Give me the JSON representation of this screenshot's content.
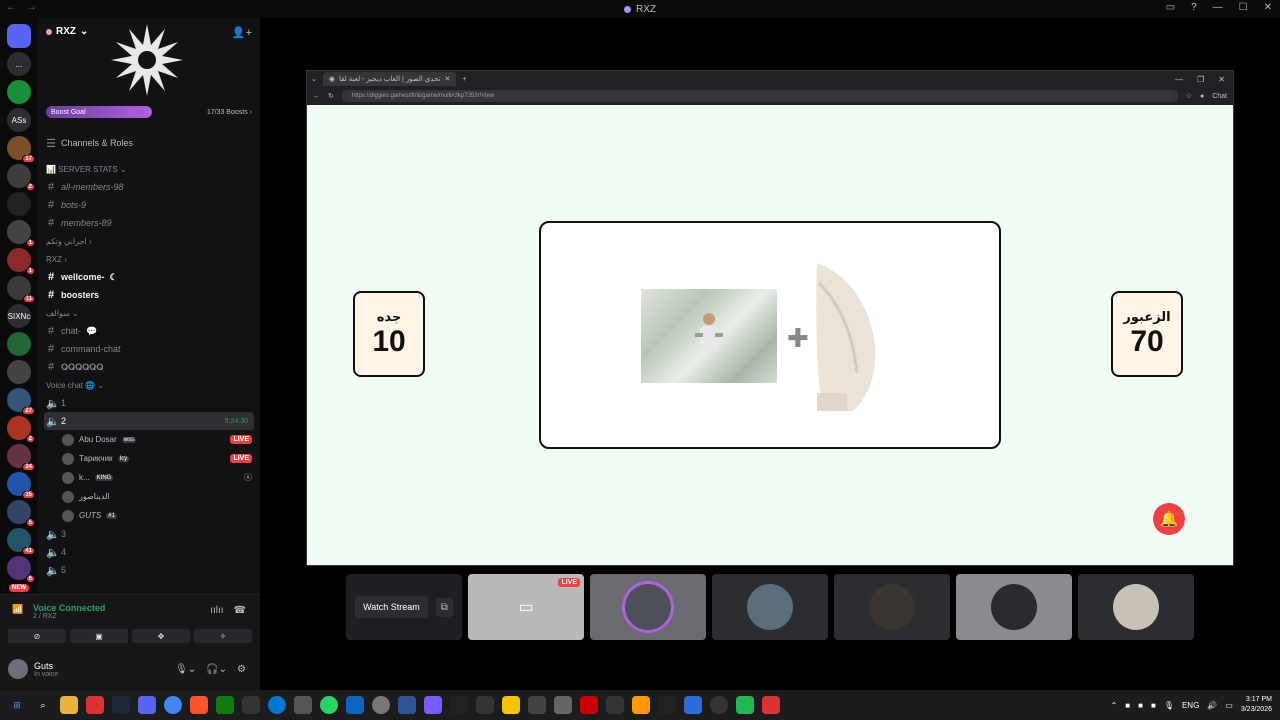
{
  "window": {
    "title": "RXZ"
  },
  "guild_rail": {
    "items": [
      {
        "name": "discord-home-icon",
        "label": "",
        "badge": ""
      },
      {
        "name": "server-icon",
        "label": "...",
        "badge": ""
      },
      {
        "name": "server-icon",
        "label": "",
        "badge": ""
      },
      {
        "name": "server-icon",
        "label": "ASs",
        "badge": ""
      },
      {
        "name": "server-icon",
        "label": "",
        "badge": "17"
      },
      {
        "name": "server-icon",
        "label": "",
        "badge": "2"
      },
      {
        "name": "server-icon",
        "label": "",
        "badge": ""
      },
      {
        "name": "server-icon",
        "label": "",
        "badge": "1"
      },
      {
        "name": "server-icon",
        "label": "",
        "badge": "1"
      },
      {
        "name": "server-icon",
        "label": "",
        "badge": "11"
      },
      {
        "name": "server-icon",
        "label": "SIXNc",
        "badge": ""
      },
      {
        "name": "server-icon",
        "label": "",
        "badge": ""
      },
      {
        "name": "server-icon",
        "label": "",
        "badge": ""
      },
      {
        "name": "server-icon",
        "label": "",
        "badge": "27"
      },
      {
        "name": "server-icon",
        "label": "",
        "badge": "2"
      },
      {
        "name": "server-icon",
        "label": "",
        "badge": "34"
      },
      {
        "name": "server-icon",
        "label": "",
        "badge": "35"
      },
      {
        "name": "server-icon",
        "label": "",
        "badge": "5"
      },
      {
        "name": "server-icon",
        "label": "",
        "badge": "41"
      },
      {
        "name": "server-icon",
        "label": "",
        "badge": "6"
      }
    ],
    "new_label": "NEW"
  },
  "server": {
    "name": "RXZ",
    "boost_label": "Boost Goal",
    "boost_count": "17/33 Boosts",
    "boost_progress": 0.515,
    "channels_roles": "Channels & Roles",
    "stats_category": "SERVER STATS",
    "channels": [
      {
        "type": "text",
        "label": "all-members-98",
        "style": "italic"
      },
      {
        "type": "text",
        "label": "bots-9",
        "style": "italic"
      },
      {
        "type": "text",
        "label": "members-89",
        "style": "italic"
      }
    ],
    "cat_arabic": "اجراني وتكم",
    "cat_rxz": "RXZ",
    "rxz_channels": [
      {
        "label": "wellcome-",
        "style": "bold"
      },
      {
        "label": "boosters",
        "style": "bold"
      }
    ],
    "cat_chat": "سوالف",
    "chat_channels": [
      {
        "label": "chat-"
      },
      {
        "label": "command-chat"
      },
      {
        "label": "𝐐𝐐𝐐𝐐𝐐𝐐"
      }
    ],
    "cat_voice": "Voice chat",
    "voice_1": "1",
    "voice_2": "2",
    "voice_2_time": "5:24:30",
    "voice_users": [
      {
        "name": "Abu Dosar",
        "tag": "wss",
        "live": "LIVE"
      },
      {
        "name": "Тарикчик",
        "tag": "Icy",
        "live": "LIVE"
      },
      {
        "name": "k...",
        "tag": "KING",
        "live": ""
      },
      {
        "name": "الديناصور",
        "tag": "",
        "live": ""
      },
      {
        "name": "GUTS",
        "tag": "#1",
        "live": ""
      }
    ],
    "voice_3": "3",
    "voice_4": "4",
    "voice_5": "5"
  },
  "voice_panel": {
    "status": "Voice Connected",
    "sub": "2 / RXZ",
    "user_name": "Guts",
    "user_status": "In voice"
  },
  "browser": {
    "tab_title": "تحدي الصور | العاب ديجيز - لعبة لقا",
    "url": "https://diggies.games/tlt/&/game/multi/cfkp7353r/View",
    "chat_label": "Chat"
  },
  "game": {
    "left_player": "جده",
    "left_score": "10",
    "right_player": "الزعبور",
    "right_score": "70"
  },
  "stream": {
    "watch_label": "Watch Stream",
    "live_label": "LIVE"
  },
  "taskbar": {
    "lang": "ENG",
    "time": "3:17 PM",
    "date": "3/23/2026"
  },
  "colors": {
    "accent_purple": "#b060e0",
    "live_red": "#f23f43",
    "connected_green": "#23a55a",
    "page_bg": "#f0fbf3"
  }
}
